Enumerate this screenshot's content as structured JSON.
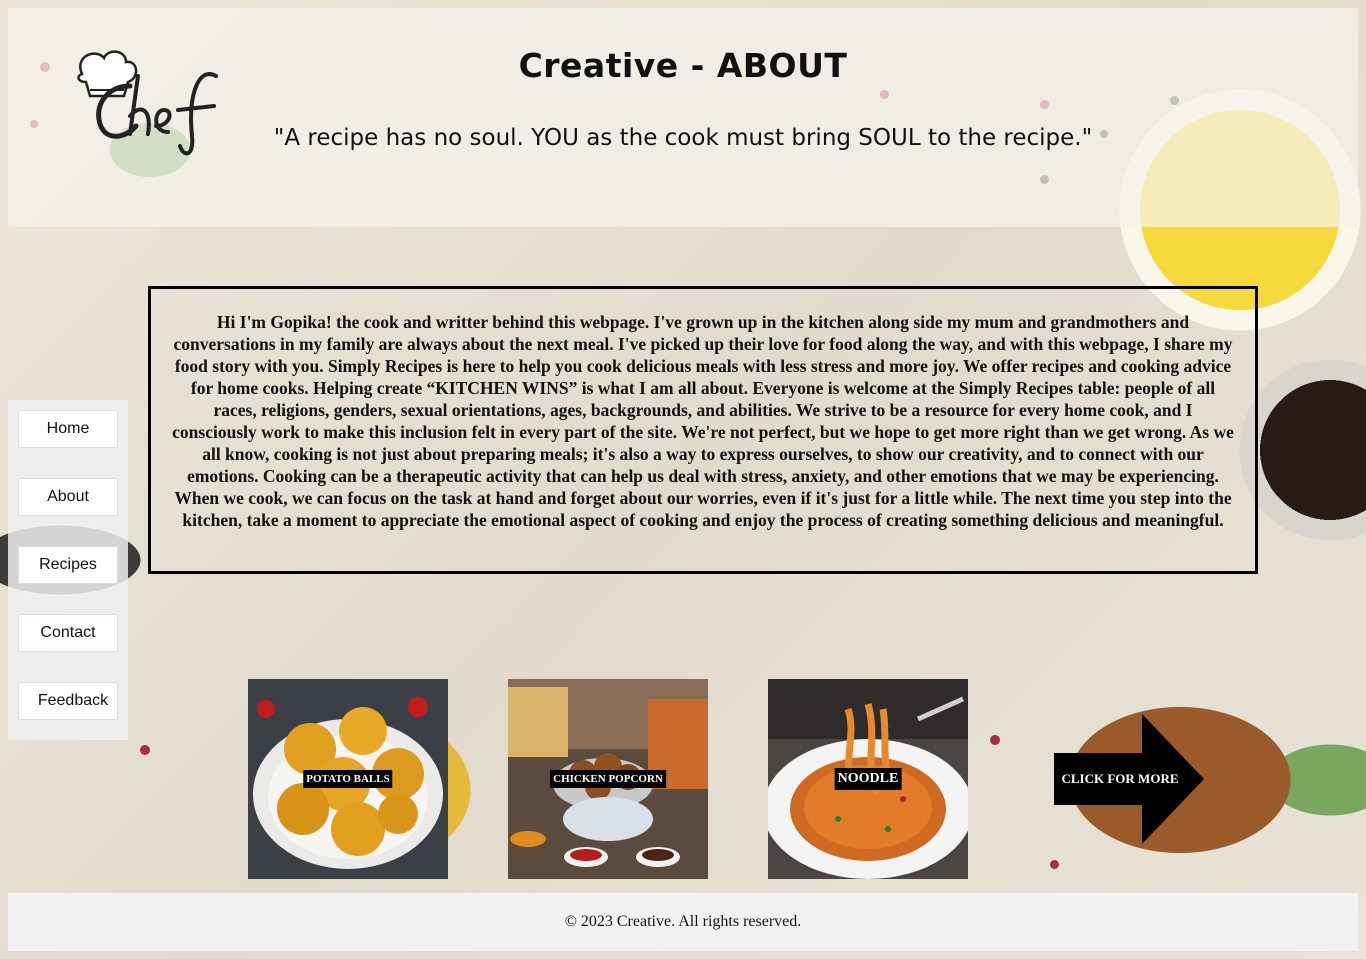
{
  "header": {
    "title": "Creative - ABOUT",
    "quote": "\"A recipe has no soul. YOU as the cook must bring SOUL to the recipe.\"",
    "logo_icon": "chef-hat-logo",
    "logo_text": "Chef"
  },
  "sidebar": {
    "items": [
      {
        "label": "Home"
      },
      {
        "label": "About"
      },
      {
        "label": "Recipes"
      },
      {
        "label": "Contact"
      },
      {
        "label": "Feedback"
      }
    ]
  },
  "about": {
    "text": "Hi I'm Gopika! the cook and writter behind this webpage. I've grown up in the kitchen along side my mum and grandmothers and conversations in my family are always about the next meal. I've picked up their love for food along the way, and with this webpage, I share my food story with you. Simply Recipes is here to help you cook delicious meals with less stress and more joy. We offer recipes and cooking advice for home cooks. Helping create “KITCHEN WINS” is what I am all about. Everyone is welcome at the Simply Recipes table: people of all races, religions, genders, sexual orientations, ages, backgrounds, and abilities. We strive to be a resource for every home cook, and I consciously work to make this inclusion felt in every part of the site. We're not perfect, but we hope to get more right than we get wrong. As we all know, cooking is not just about preparing meals; it's also a way to express ourselves, to show our creativity, and to connect with our emotions. Cooking can be a therapeutic activity that can help us deal with stress, anxiety, and other emotions that we may be experiencing. When we cook, we can focus on the task at hand and forget about our worries, even if it's just for a little while. The next time you step into the kitchen, take a moment to appreciate the emotional aspect of cooking and enjoy the process of creating something delicious and meaningful."
  },
  "recipes": [
    {
      "label": "POTATO BALLS"
    },
    {
      "label": "CHICKEN POPCORN"
    },
    {
      "label": "NOODLE"
    }
  ],
  "more": {
    "label": "CLICK FOR MORE",
    "icon": "arrow-right-icon"
  },
  "footer": {
    "text": "© 2023 Creative. All rights reserved."
  },
  "colors": {
    "accent": "#000000",
    "panel": "#f2f2f2"
  }
}
